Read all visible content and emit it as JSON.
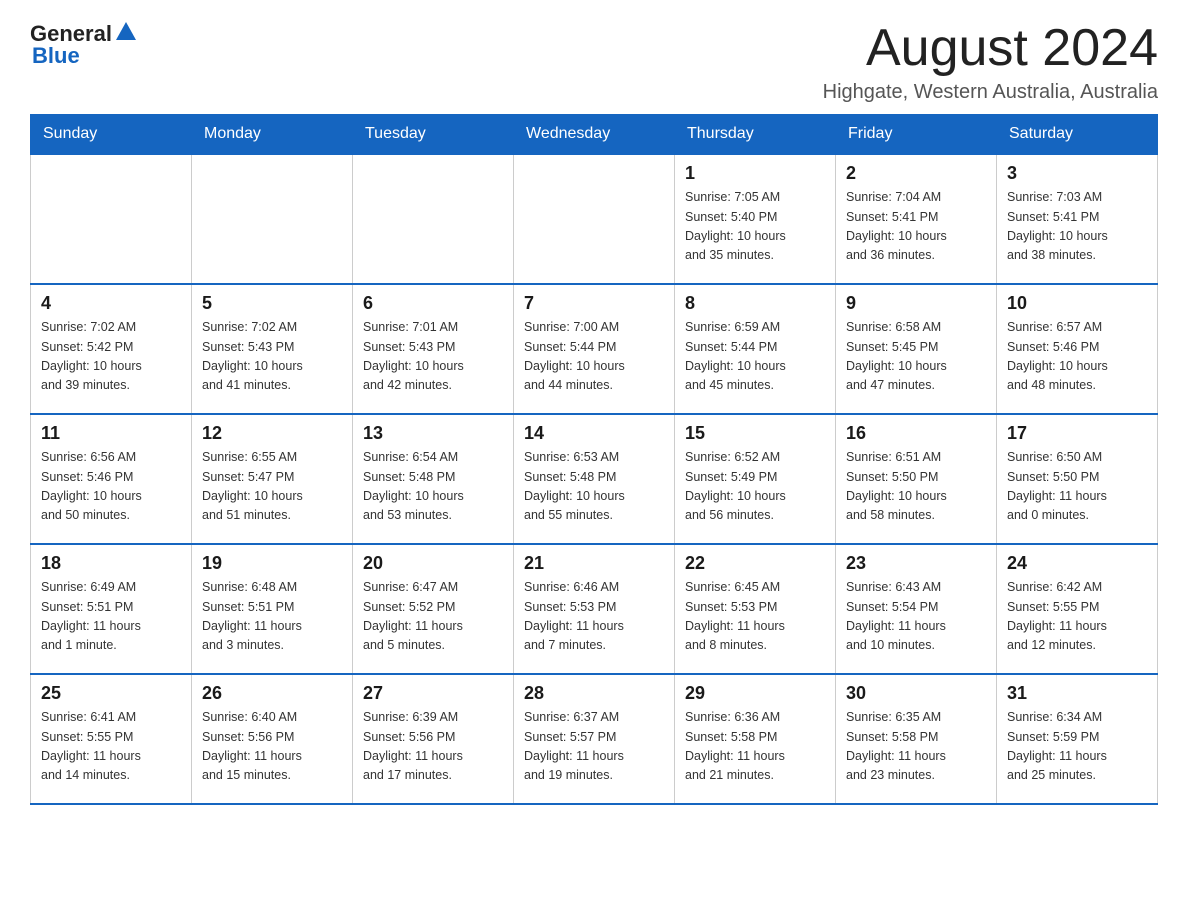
{
  "header": {
    "logo": {
      "general": "General",
      "blue": "Blue"
    },
    "title": "August 2024",
    "location": "Highgate, Western Australia, Australia"
  },
  "calendar": {
    "days_of_week": [
      "Sunday",
      "Monday",
      "Tuesday",
      "Wednesday",
      "Thursday",
      "Friday",
      "Saturday"
    ],
    "weeks": [
      [
        {
          "day": "",
          "info": ""
        },
        {
          "day": "",
          "info": ""
        },
        {
          "day": "",
          "info": ""
        },
        {
          "day": "",
          "info": ""
        },
        {
          "day": "1",
          "info": "Sunrise: 7:05 AM\nSunset: 5:40 PM\nDaylight: 10 hours\nand 35 minutes."
        },
        {
          "day": "2",
          "info": "Sunrise: 7:04 AM\nSunset: 5:41 PM\nDaylight: 10 hours\nand 36 minutes."
        },
        {
          "day": "3",
          "info": "Sunrise: 7:03 AM\nSunset: 5:41 PM\nDaylight: 10 hours\nand 38 minutes."
        }
      ],
      [
        {
          "day": "4",
          "info": "Sunrise: 7:02 AM\nSunset: 5:42 PM\nDaylight: 10 hours\nand 39 minutes."
        },
        {
          "day": "5",
          "info": "Sunrise: 7:02 AM\nSunset: 5:43 PM\nDaylight: 10 hours\nand 41 minutes."
        },
        {
          "day": "6",
          "info": "Sunrise: 7:01 AM\nSunset: 5:43 PM\nDaylight: 10 hours\nand 42 minutes."
        },
        {
          "day": "7",
          "info": "Sunrise: 7:00 AM\nSunset: 5:44 PM\nDaylight: 10 hours\nand 44 minutes."
        },
        {
          "day": "8",
          "info": "Sunrise: 6:59 AM\nSunset: 5:44 PM\nDaylight: 10 hours\nand 45 minutes."
        },
        {
          "day": "9",
          "info": "Sunrise: 6:58 AM\nSunset: 5:45 PM\nDaylight: 10 hours\nand 47 minutes."
        },
        {
          "day": "10",
          "info": "Sunrise: 6:57 AM\nSunset: 5:46 PM\nDaylight: 10 hours\nand 48 minutes."
        }
      ],
      [
        {
          "day": "11",
          "info": "Sunrise: 6:56 AM\nSunset: 5:46 PM\nDaylight: 10 hours\nand 50 minutes."
        },
        {
          "day": "12",
          "info": "Sunrise: 6:55 AM\nSunset: 5:47 PM\nDaylight: 10 hours\nand 51 minutes."
        },
        {
          "day": "13",
          "info": "Sunrise: 6:54 AM\nSunset: 5:48 PM\nDaylight: 10 hours\nand 53 minutes."
        },
        {
          "day": "14",
          "info": "Sunrise: 6:53 AM\nSunset: 5:48 PM\nDaylight: 10 hours\nand 55 minutes."
        },
        {
          "day": "15",
          "info": "Sunrise: 6:52 AM\nSunset: 5:49 PM\nDaylight: 10 hours\nand 56 minutes."
        },
        {
          "day": "16",
          "info": "Sunrise: 6:51 AM\nSunset: 5:50 PM\nDaylight: 10 hours\nand 58 minutes."
        },
        {
          "day": "17",
          "info": "Sunrise: 6:50 AM\nSunset: 5:50 PM\nDaylight: 11 hours\nand 0 minutes."
        }
      ],
      [
        {
          "day": "18",
          "info": "Sunrise: 6:49 AM\nSunset: 5:51 PM\nDaylight: 11 hours\nand 1 minute."
        },
        {
          "day": "19",
          "info": "Sunrise: 6:48 AM\nSunset: 5:51 PM\nDaylight: 11 hours\nand 3 minutes."
        },
        {
          "day": "20",
          "info": "Sunrise: 6:47 AM\nSunset: 5:52 PM\nDaylight: 11 hours\nand 5 minutes."
        },
        {
          "day": "21",
          "info": "Sunrise: 6:46 AM\nSunset: 5:53 PM\nDaylight: 11 hours\nand 7 minutes."
        },
        {
          "day": "22",
          "info": "Sunrise: 6:45 AM\nSunset: 5:53 PM\nDaylight: 11 hours\nand 8 minutes."
        },
        {
          "day": "23",
          "info": "Sunrise: 6:43 AM\nSunset: 5:54 PM\nDaylight: 11 hours\nand 10 minutes."
        },
        {
          "day": "24",
          "info": "Sunrise: 6:42 AM\nSunset: 5:55 PM\nDaylight: 11 hours\nand 12 minutes."
        }
      ],
      [
        {
          "day": "25",
          "info": "Sunrise: 6:41 AM\nSunset: 5:55 PM\nDaylight: 11 hours\nand 14 minutes."
        },
        {
          "day": "26",
          "info": "Sunrise: 6:40 AM\nSunset: 5:56 PM\nDaylight: 11 hours\nand 15 minutes."
        },
        {
          "day": "27",
          "info": "Sunrise: 6:39 AM\nSunset: 5:56 PM\nDaylight: 11 hours\nand 17 minutes."
        },
        {
          "day": "28",
          "info": "Sunrise: 6:37 AM\nSunset: 5:57 PM\nDaylight: 11 hours\nand 19 minutes."
        },
        {
          "day": "29",
          "info": "Sunrise: 6:36 AM\nSunset: 5:58 PM\nDaylight: 11 hours\nand 21 minutes."
        },
        {
          "day": "30",
          "info": "Sunrise: 6:35 AM\nSunset: 5:58 PM\nDaylight: 11 hours\nand 23 minutes."
        },
        {
          "day": "31",
          "info": "Sunrise: 6:34 AM\nSunset: 5:59 PM\nDaylight: 11 hours\nand 25 minutes."
        }
      ]
    ]
  }
}
